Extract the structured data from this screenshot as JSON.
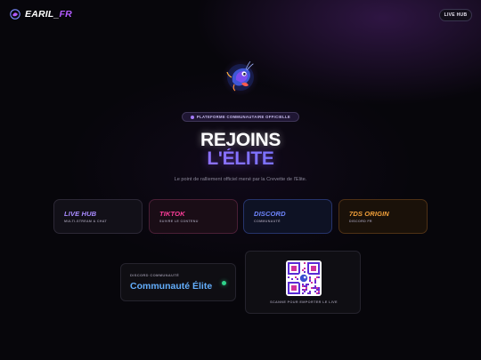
{
  "header": {
    "brand_part1": "EARIL_",
    "brand_part2": "FR",
    "brand_icon": "shrimp-logo-icon",
    "live_hub_label": "LIVE HUB"
  },
  "hero": {
    "mascot_icon": "shrimp-mascot",
    "badge": "PLATEFORME COMMUNAUTAIRE OFFICIELLE",
    "title_line1": "REJOINS",
    "title_line2": "L'ÉLITE",
    "subtitle": "Le point de ralliement officiel mené par la Crevette de l'Elite."
  },
  "platforms": [
    {
      "name": "LIVE HUB",
      "subtitle": "MULTI-STREAM & CHAT",
      "color": "#a98bff"
    },
    {
      "name": "TIKTOK",
      "subtitle": "SUIVRE LE CONTENU",
      "color": "#ff3d9a"
    },
    {
      "name": "DISCORD",
      "subtitle": "COMMUNAUTÉ",
      "color": "#6f86ff"
    },
    {
      "name": "7DS ORIGIN",
      "subtitle": "DISCORD FR",
      "color": "#f3a13a"
    }
  ],
  "community": {
    "label": "DISCORD COMMUNAUTÉ",
    "title": "Communauté Élite",
    "status_color": "#2fd38a"
  },
  "qr": {
    "caption": "SCANNE POUR EMPORTER LE LIVE",
    "center_icon": "shrimp-logo-icon"
  },
  "colors": {
    "accent_purple": "#b35cff",
    "background": "#07060b"
  }
}
